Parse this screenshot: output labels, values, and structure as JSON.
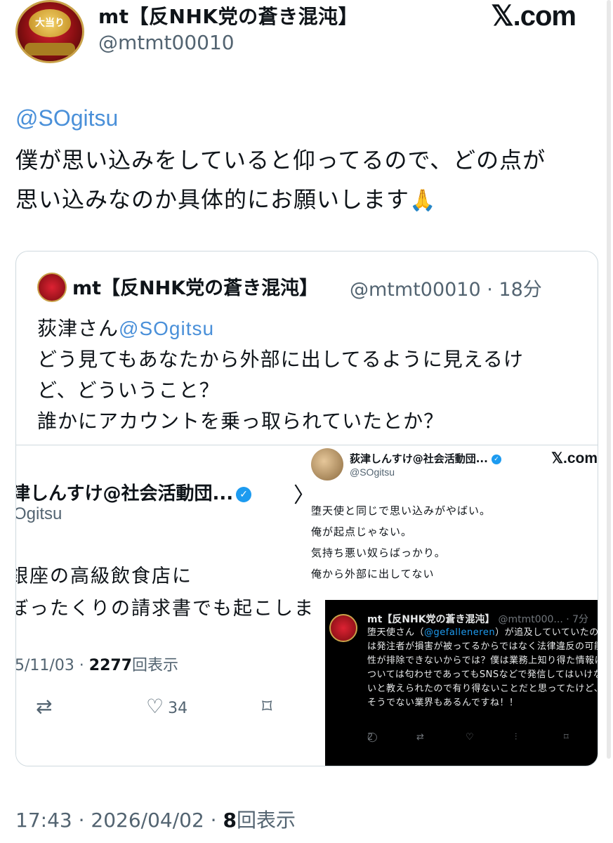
{
  "header": {
    "display_name": "mt【反NHK党の蒼き混沌】",
    "handle": "@mtmt00010",
    "brand": "𝕏.com",
    "avatar_badge": "大当り"
  },
  "tweet": {
    "mention": "@SOgitsu",
    "line1": "僕が思い込みをしていると仰ってるので、どの点が",
    "line2": "思い込みなのか具体的にお願いします",
    "emoji": "🙏"
  },
  "quote": {
    "name": "mt【反NHK党の蒼き混沌】",
    "meta": "@mtmt00010 · 18分",
    "line1_prefix": "荻津さん",
    "line1_mention": "@SOgitsu",
    "line2": "どう見てもあなたから外部に出してるように見えるけ",
    "line3": "ど、どういうこと？",
    "line4": "誰かにアカウントを乗っ取られていたとか？"
  },
  "media_left": {
    "name": "津しんすけ@社会活動団...",
    "handle": "Ogitsu",
    "line1": "銀座の高級飲食店に",
    "line2": "ぼったくりの請求書でも起こしま",
    "date": "5/11/03 · ",
    "views_count": "2277",
    "views_label": "回表示",
    "likes": "34",
    "chevron": "〉"
  },
  "media_right": {
    "name": "荻津しんすけ@社会活動団...",
    "handle": "@SOgitsu",
    "brand": "𝕏.com",
    "lines": [
      "堕天使と同じで思い込みがやばい。",
      "俺が起点じゃない。",
      "気持ち悪い奴らばっかり。",
      "俺から外部に出してない"
    ]
  },
  "dark_card": {
    "name": "mt【反NHK党の蒼き混沌】",
    "handle": "@mtmt000... · 7分",
    "text_prefix": "堕天使さん（",
    "text_mention": "@gefalleneren",
    "text_rest": "）が追及していていたのは発注者が損害が被ってるからではなく法律違反の可能性が排除できないからでは？僕は業務上知り得た情報については匂わせであってもSNSなどで発信してはいけないと教えられたので有り得ないことだと思ってたけど、そうでない業界もあるんですね！！",
    "replies": "2"
  },
  "footer": {
    "time_date": "17:43 · 2026/04/02 · ",
    "views_count": "8",
    "views_label": "回表示"
  },
  "colors": {
    "link": "#4a90d9",
    "muted": "#536471",
    "border": "#cfd9de"
  }
}
